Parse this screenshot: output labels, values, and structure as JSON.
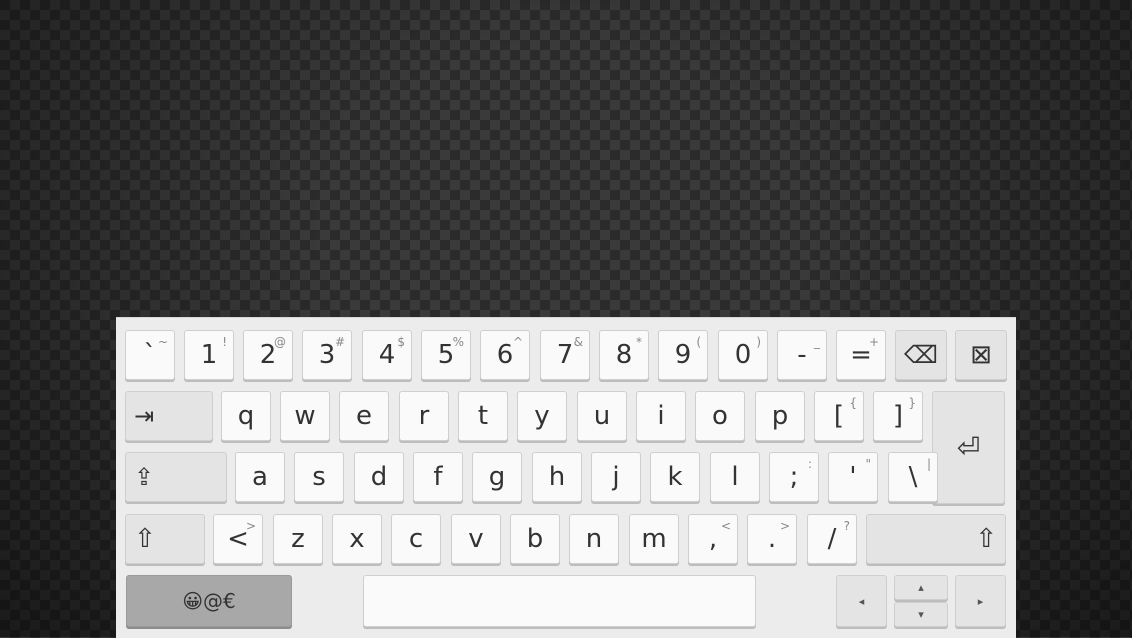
{
  "keyboard": {
    "row1": [
      {
        "main": "`",
        "sec": "~"
      },
      {
        "main": "1",
        "sec": "!"
      },
      {
        "main": "2",
        "sec": "@"
      },
      {
        "main": "3",
        "sec": "#"
      },
      {
        "main": "4",
        "sec": "$"
      },
      {
        "main": "5",
        "sec": "%"
      },
      {
        "main": "6",
        "sec": "^"
      },
      {
        "main": "7",
        "sec": "&"
      },
      {
        "main": "8",
        "sec": "*"
      },
      {
        "main": "9",
        "sec": "("
      },
      {
        "main": "0",
        "sec": ")"
      },
      {
        "main": "-",
        "sec": "_"
      },
      {
        "main": "=",
        "sec": "+"
      }
    ],
    "backspace_icon": "⌫",
    "close_icon": "⊠",
    "tab_icon": "⇥",
    "row2": [
      {
        "main": "q"
      },
      {
        "main": "w"
      },
      {
        "main": "e"
      },
      {
        "main": "r"
      },
      {
        "main": "t"
      },
      {
        "main": "y"
      },
      {
        "main": "u"
      },
      {
        "main": "i"
      },
      {
        "main": "o"
      },
      {
        "main": "p"
      },
      {
        "main": "[",
        "sec": "{"
      },
      {
        "main": "]",
        "sec": "}"
      }
    ],
    "enter_icon": "⏎",
    "capslock_icon": "⇪",
    "row3": [
      {
        "main": "a"
      },
      {
        "main": "s"
      },
      {
        "main": "d"
      },
      {
        "main": "f"
      },
      {
        "main": "g"
      },
      {
        "main": "h"
      },
      {
        "main": "j"
      },
      {
        "main": "k"
      },
      {
        "main": "l"
      },
      {
        "main": ";",
        "sec": ":"
      },
      {
        "main": "'",
        "sec": "\""
      },
      {
        "main": "\\",
        "sec": "|"
      }
    ],
    "shift_icon": "⇧",
    "row4": [
      {
        "main": "<",
        "sec": ">"
      },
      {
        "main": "z"
      },
      {
        "main": "x"
      },
      {
        "main": "c"
      },
      {
        "main": "v"
      },
      {
        "main": "b"
      },
      {
        "main": "n"
      },
      {
        "main": "m"
      },
      {
        "main": ",",
        "sec": "<"
      },
      {
        "main": ".",
        "sec": ">"
      },
      {
        "main": "/",
        "sec": "?"
      }
    ],
    "emoji_label": "😀@€",
    "arrow_left": "◂",
    "arrow_up": "▴",
    "arrow_down": "▾",
    "arrow_right": "▸"
  }
}
